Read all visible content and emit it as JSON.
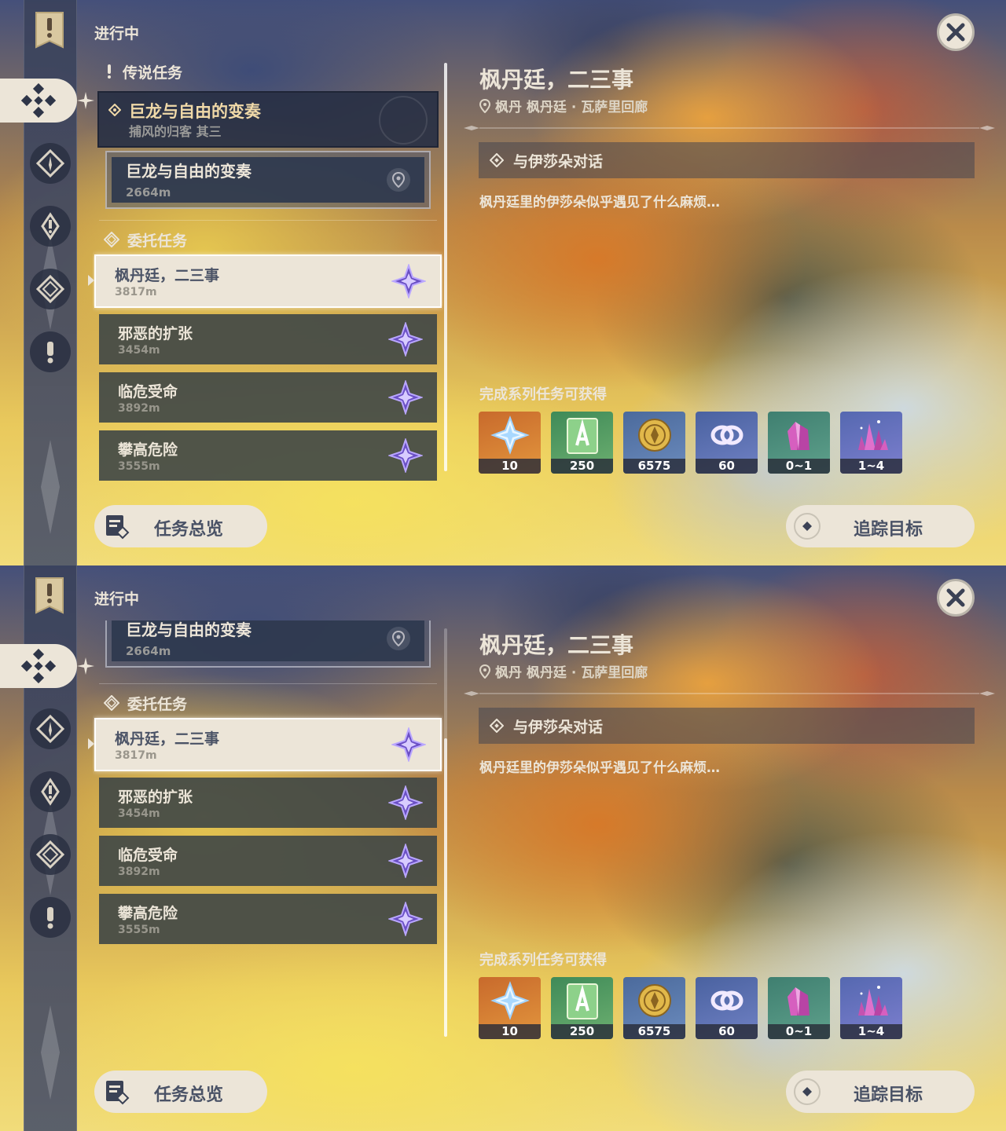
{
  "screens": [
    {
      "ongoing_label": "进行中",
      "legend_section": "传说任务",
      "legend_quest": {
        "title": "巨龙与自由的变奏",
        "subtitle": "捕风的归客 其三"
      },
      "legend_sub": {
        "title": "巨龙与自由的变奏",
        "distance": "2664m"
      },
      "commission_section": "委托任务",
      "quests": [
        {
          "title": "枫丹廷，二三事",
          "distance": "3817m"
        },
        {
          "title": "邪恶的扩张",
          "distance": "3454m"
        },
        {
          "title": "临危受命",
          "distance": "3892m"
        },
        {
          "title": "攀高危险",
          "distance": "3555m"
        }
      ],
      "detail": {
        "title": "枫丹廷，二三事",
        "location": "枫丹 枫丹廷 · 瓦萨里回廊",
        "objective": "与伊莎朵对话",
        "description": "枫丹廷里的伊莎朵似乎遇见了什么麻烦…",
        "reward_heading": "完成系列任务可获得",
        "rewards": [
          {
            "icon": "primogem-icon",
            "qty": "10"
          },
          {
            "icon": "adventure-exp-icon",
            "qty": "250"
          },
          {
            "icon": "mora-icon",
            "qty": "6575"
          },
          {
            "icon": "companionship-exp-icon",
            "qty": "60"
          },
          {
            "icon": "crystal-chunk-icon",
            "qty": "0~1"
          },
          {
            "icon": "crystal-cluster-icon",
            "qty": "1~4"
          }
        ]
      },
      "overview_button": "任务总览",
      "track_button": "追踪目标"
    },
    {
      "ongoing_label": "进行中",
      "legend_sub": {
        "title": "巨龙与自由的变奏",
        "distance": "2664m"
      },
      "commission_section": "委托任务",
      "quests": [
        {
          "title": "枫丹廷，二三事",
          "distance": "3817m"
        },
        {
          "title": "邪恶的扩张",
          "distance": "3454m"
        },
        {
          "title": "临危受命",
          "distance": "3892m"
        },
        {
          "title": "攀高危险",
          "distance": "3555m"
        }
      ],
      "detail": {
        "title": "枫丹廷，二三事",
        "location": "枫丹 枫丹廷 · 瓦萨里回廊",
        "objective": "与伊莎朵对话",
        "description": "枫丹廷里的伊莎朵似乎遇见了什么麻烦…",
        "reward_heading": "完成系列任务可获得",
        "rewards": [
          {
            "icon": "primogem-icon",
            "qty": "10"
          },
          {
            "icon": "adventure-exp-icon",
            "qty": "250"
          },
          {
            "icon": "mora-icon",
            "qty": "6575"
          },
          {
            "icon": "companionship-exp-icon",
            "qty": "60"
          },
          {
            "icon": "crystal-chunk-icon",
            "qty": "0~1"
          },
          {
            "icon": "crystal-cluster-icon",
            "qty": "1~4"
          }
        ]
      },
      "overview_button": "任务总览",
      "track_button": "追踪目标"
    }
  ],
  "colors": {
    "cream": "#ece5d8",
    "legend_gold": "#f0d9a8",
    "commission_purple": "#8a6ad8",
    "text_dark": "#4a5266"
  }
}
